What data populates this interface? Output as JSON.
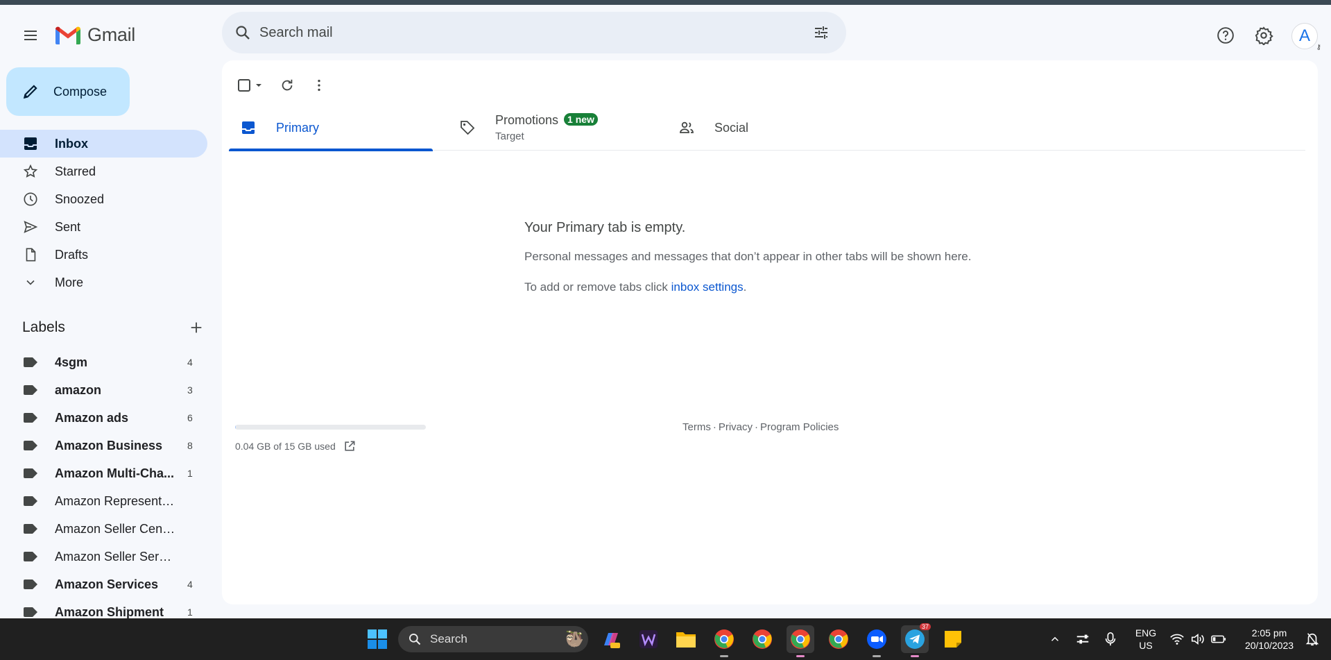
{
  "app": {
    "name": "Gmail"
  },
  "search": {
    "placeholder": "Search mail"
  },
  "header": {
    "avatar_letter": "A"
  },
  "compose": {
    "label": "Compose"
  },
  "nav": {
    "items": [
      {
        "label": "Inbox",
        "icon": "inbox-icon",
        "active": true
      },
      {
        "label": "Starred",
        "icon": "star-icon"
      },
      {
        "label": "Snoozed",
        "icon": "clock-icon"
      },
      {
        "label": "Sent",
        "icon": "send-icon"
      },
      {
        "label": "Drafts",
        "icon": "draft-icon"
      },
      {
        "label": "More",
        "icon": "chevron-down-icon"
      }
    ]
  },
  "labels": {
    "title": "Labels",
    "items": [
      {
        "name": "4sgm",
        "count": "4",
        "bold": true
      },
      {
        "name": "amazon",
        "count": "3",
        "bold": true
      },
      {
        "name": "Amazon ads",
        "count": "6",
        "bold": true
      },
      {
        "name": "Amazon Business",
        "count": "8",
        "bold": true
      },
      {
        "name": "Amazon Multi-Cha...",
        "count": "1",
        "bold": true
      },
      {
        "name": "Amazon Representative",
        "count": "",
        "bold": false
      },
      {
        "name": "Amazon Seller Central",
        "count": "",
        "bold": false
      },
      {
        "name": "Amazon Seller Services",
        "count": "",
        "bold": false
      },
      {
        "name": "Amazon Services",
        "count": "4",
        "bold": true
      },
      {
        "name": "Amazon Shipment",
        "count": "1",
        "bold": true
      }
    ]
  },
  "tabs": [
    {
      "label": "Primary",
      "active": true
    },
    {
      "label": "Promotions",
      "badge": "1 new",
      "sub": "Target"
    },
    {
      "label": "Social"
    }
  ],
  "empty": {
    "title": "Your Primary tab is empty.",
    "text": "Personal messages and messages that don’t appear in other tabs will be shown here.",
    "settings_prefix": "To add or remove tabs click ",
    "settings_link": "inbox settings",
    "settings_suffix": "."
  },
  "storage": {
    "text": "0.04 GB of 15 GB used",
    "fraction": 0.003
  },
  "footer": {
    "terms": "Terms",
    "privacy": "Privacy",
    "policies": "Program Policies",
    "sep": "·"
  },
  "taskbar": {
    "search_label": "Search",
    "lang": "ENG",
    "region": "US",
    "time": "2:05 pm",
    "date": "20/10/2023",
    "telegram_badge": "37"
  },
  "colors": {
    "accent": "#0b57d0",
    "compose": "#c2e7ff",
    "active_nav": "#d3e3fd",
    "badge_green": "#188038"
  }
}
